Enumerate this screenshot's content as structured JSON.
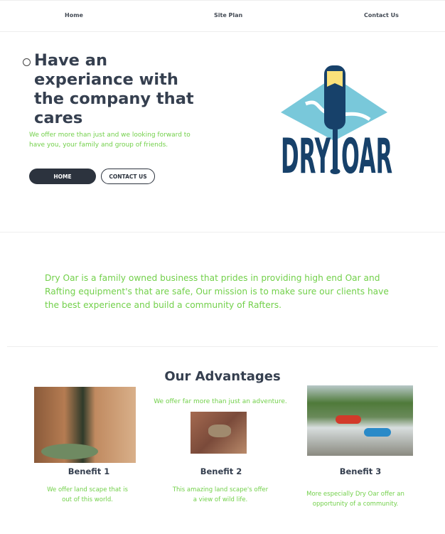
{
  "nav": {
    "items": [
      {
        "label": "Home"
      },
      {
        "label": "Site Plan"
      },
      {
        "label": "Contact Us"
      }
    ]
  },
  "hero": {
    "title": "Have an experiance with the company that cares",
    "subtitle": "We offer more than just and we looking forward to have you, your family and group of friends.",
    "buttons": {
      "home": "HOME",
      "contact": "CONTACT US"
    },
    "logo_text": "DRY OAR"
  },
  "about": {
    "text": "Dry Oar is a family owned business that prides in providing high end Oar and Rafting equipment's that are safe, Our mission is to make sure our clients have the best experience and build a community of Rafters."
  },
  "advantages": {
    "title": "Our Advantages",
    "subtitle": "We offer far more than just an adventure.",
    "items": [
      {
        "title": "Benefit 1",
        "text": "We offer land scape that is out of this world."
      },
      {
        "title": "Benefit 2",
        "text": "This amazing land scape's offer a view of wild life."
      },
      {
        "title": "Benefit 3",
        "text": "More especially Dry Oar offer an opportunity of a community."
      }
    ]
  },
  "colors": {
    "accent": "#72d04a",
    "heading": "#353f4f",
    "button_dark": "#2c333e",
    "logo_navy": "#17416a",
    "logo_water": "#79c8da",
    "logo_yellow": "#fbe17a"
  }
}
